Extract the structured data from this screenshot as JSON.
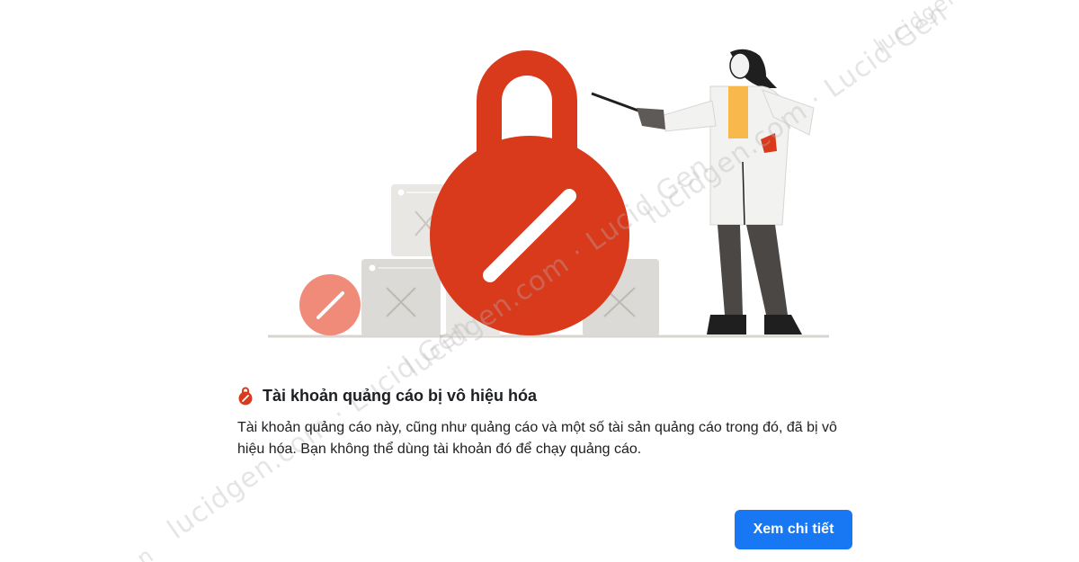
{
  "dialog": {
    "title": "Tài khoản quảng cáo bị vô hiệu hóa",
    "description": "Tài khoản quảng cáo này, cũng như quảng cáo và một số tài sản quảng cáo trong đó, đã bị vô hiệu hóa. Bạn không thể dùng tài khoản đó để chạy quảng cáo.",
    "button_label": "Xem chi tiết",
    "title_icon": "restricted-lock-icon"
  },
  "watermarks": {
    "wm1": "lucidgen",
    "wm2": "lucidgen.com · Lucid Gen",
    "wm3": "lucidgen.com · Lucid Gen",
    "wm4": "lucidgen.com · Lucid Gen",
    "wm5": "n"
  },
  "colors": {
    "accent": "#1877f2",
    "lock_red": "#d93a1c",
    "lock_light": "#f08b7a",
    "box_gray": "#dcdad6",
    "text": "#1c1e21"
  }
}
